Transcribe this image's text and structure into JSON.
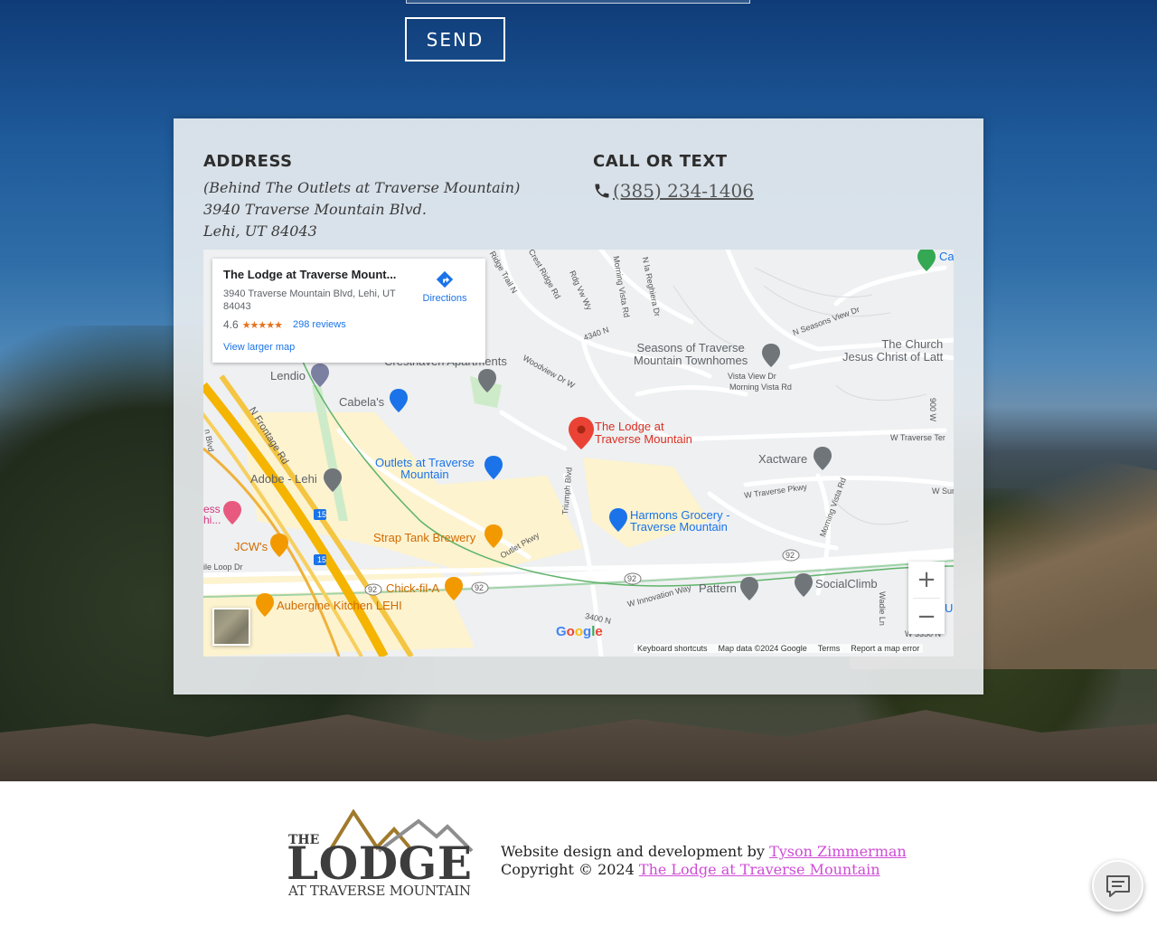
{
  "form": {
    "send_label": "SEND"
  },
  "address": {
    "heading": "ADDRESS",
    "line1": "(Behind The Outlets at Traverse Mountain)",
    "line2": "3940 Traverse Mountain Blvd.",
    "line3": "Lehi, UT 84043"
  },
  "contact": {
    "heading": "CALL OR TEXT",
    "phone": "(385) 234-1406",
    "phone_icon": "phone-icon"
  },
  "map": {
    "place_card": {
      "title": "The Lodge at Traverse Mount...",
      "address": "3940 Traverse Mountain Blvd, Lehi, UT 84043",
      "rating": "4.6",
      "stars": "★★★★★",
      "reviews": "298 reviews",
      "directions": "Directions",
      "view_larger": "View larger map"
    },
    "labels": {
      "lodge": "The Lodge at\nTraverse Mountain",
      "seasons": "Seasons of Traverse\nMountain Townhomes",
      "church": "The Church\nJesus Christ of Latt",
      "lendio": "Lendio",
      "cabelas": "Cabela's",
      "outlets": "Outlets at Traverse\nMountain",
      "adobe": "Adobe - Lehi",
      "xactware": "Xactware",
      "harmons": "Harmons Grocery -\nTraverse Mountain",
      "strap_tank": "Strap Tank Brewery",
      "jcws": "JCW's",
      "chickfila": "Chick-fil-A",
      "aubergine": "Aubergine Kitchen LEHI",
      "pattern": "Pattern",
      "socialclimb": "SocialClimb",
      "crest_haven": "Cresthaven Apartments",
      "ess": "ess\nhi...",
      "ca": "Ca",
      "u": "U"
    },
    "roads": {
      "n_frontage": "N Frontage Rd",
      "woodview": "Woodview Dr W",
      "n_4340": "4340 N",
      "seasons_view": "N Seasons View Dr",
      "vista_view": "Vista View Dr",
      "morning_vista": "Morning Vista Rd",
      "w_traverse_pkwy": "W Traverse Pkwy",
      "w_traverse_ter": "W Traverse Ter",
      "w_sun": "W Sun",
      "triumph": "Triumph Blvd",
      "outlet_pkwy": "Outlet Pkwy",
      "innovation": "W Innovation Way",
      "n_3400": "3400 N",
      "morning_vista_rd2": "Morning Vista Rd",
      "wadie": "Wadie Ln",
      "crest_ridge": "N Crest Ridge Rd",
      "ridge_trail": "Ridge Trail N",
      "rdg_vw": "Rdg Vw Wy",
      "morning_vista_dr": "Morning Vista Rd",
      "regiera": "N la Reghiera Dr",
      "e_900": "900 W",
      "ile_loop": "ile Loop Dr",
      "n_blvd": "n Blvd",
      "w_3350": "W 3350 N",
      "rt92a": "92",
      "rt92b": "92",
      "rt92c": "92",
      "rt92d": "92",
      "rt15a": "15",
      "rt15b": "15"
    },
    "google": "Google",
    "footer": {
      "shortcuts": "Keyboard shortcuts",
      "data": "Map data ©2024 Google",
      "terms": "Terms",
      "report": "Report a map error"
    },
    "zoom_in": "+",
    "zoom_out": "−"
  },
  "footer": {
    "logo_the": "THE",
    "logo_lodge": "LODGE",
    "logo_sub": "AT TRAVERSE MOUNTAIN",
    "credit_text": "Website design and development by",
    "credit_link": "Tyson Zimmerman",
    "copyright_text": "Copyright © 2024",
    "copyright_link": "The Lodge at Traverse Mountain"
  },
  "colors": {
    "map_blue": "#1a73e8",
    "map_pin_red": "#ea4335",
    "link_pink": "#cf4bd6",
    "logo_gold": "#a07a2c",
    "logo_gray": "#3d3d3d"
  }
}
